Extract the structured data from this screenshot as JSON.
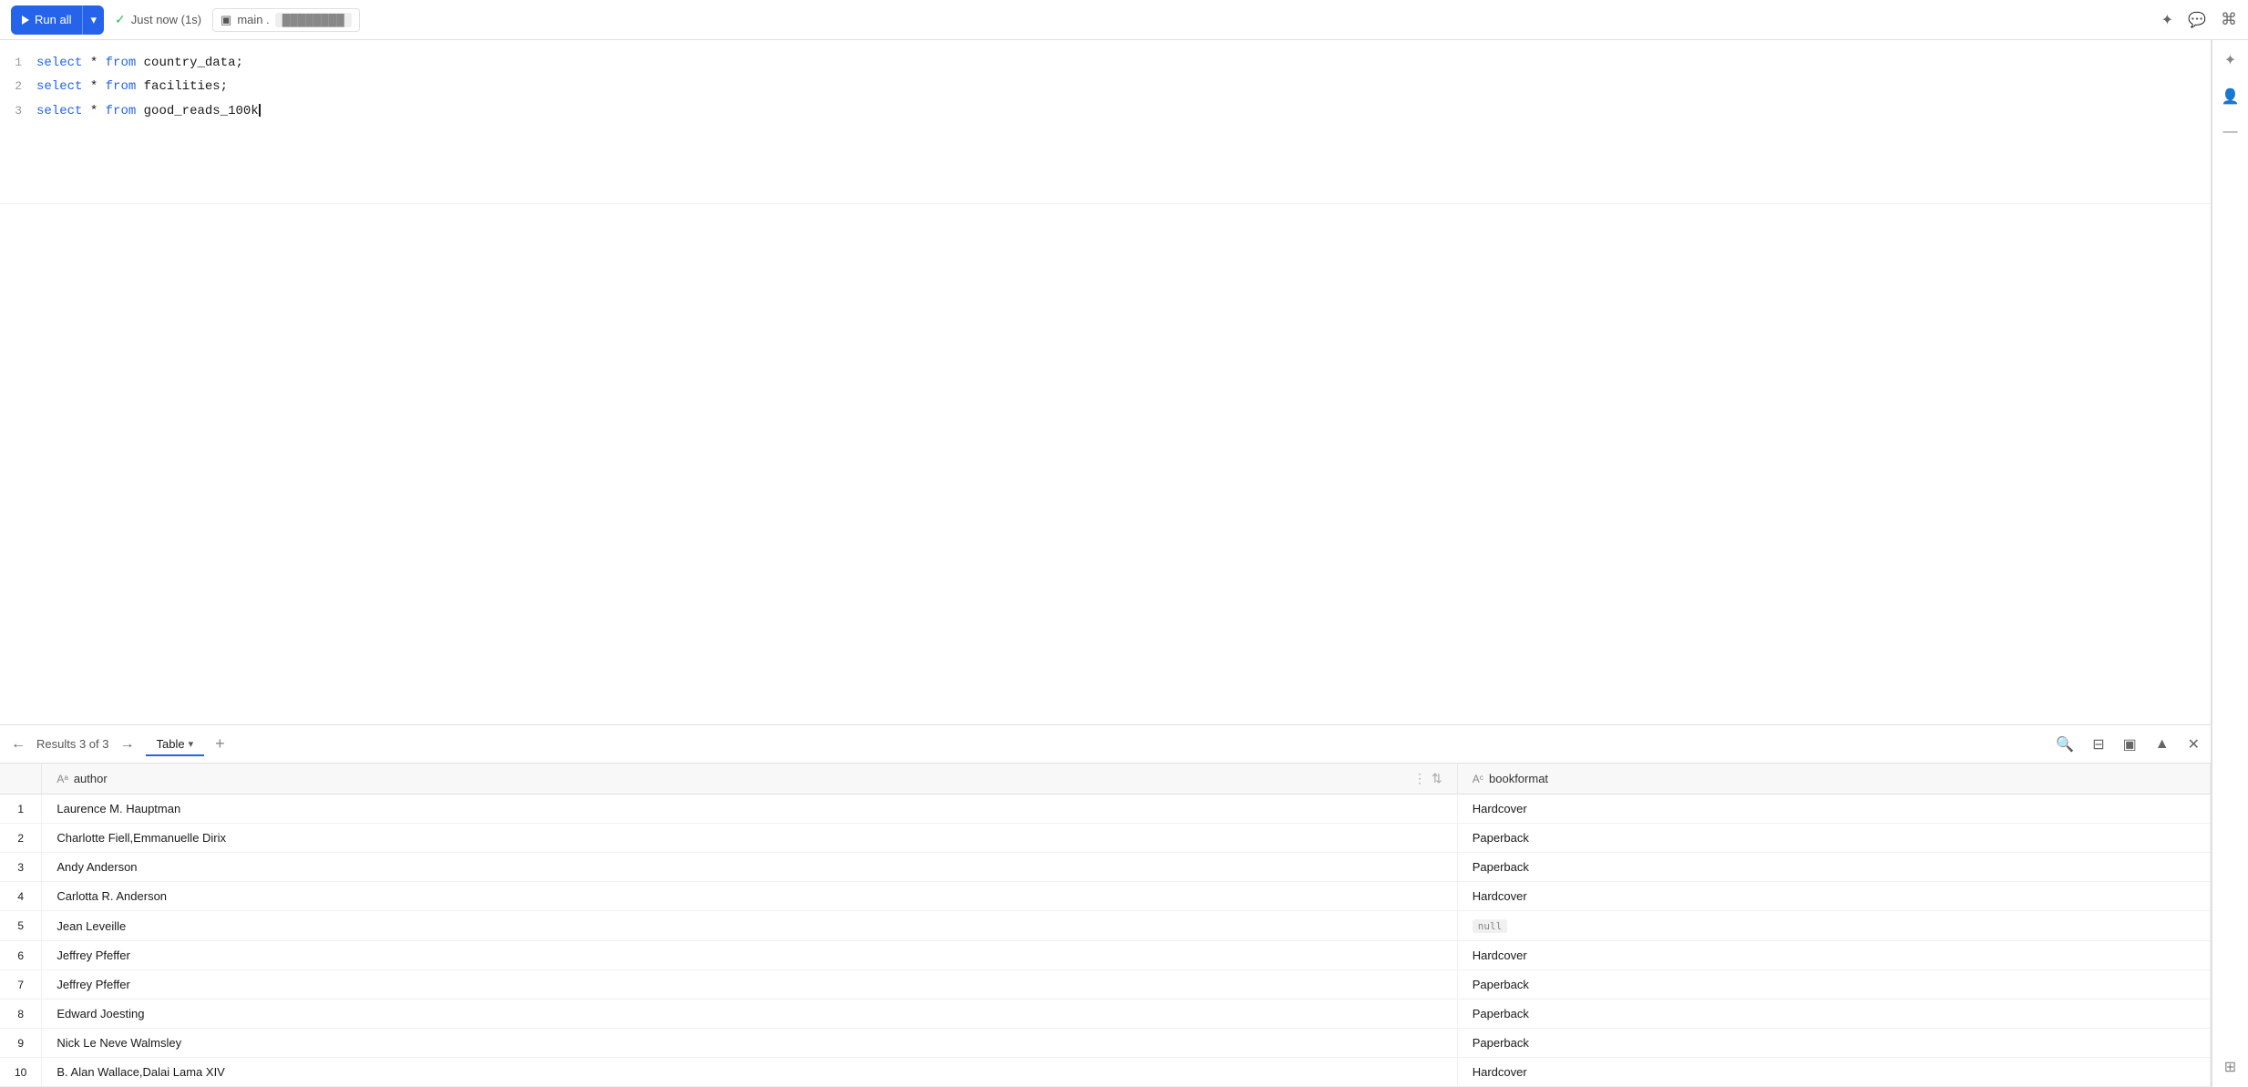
{
  "toolbar": {
    "run_all_label": "Run all",
    "status_label": "Just now (1s)",
    "db_label": "main .",
    "pin_icon": "✦",
    "chat_icon": "💬",
    "cmd_icon": "⌘"
  },
  "editor": {
    "lines": [
      {
        "number": 1,
        "content": "select * from country_data;"
      },
      {
        "number": 2,
        "content": "select * from facilities;"
      },
      {
        "number": 3,
        "content": "select * from good_reads_100k"
      }
    ]
  },
  "results": {
    "label": "Results 3 of 3",
    "tab_label": "Table",
    "columns": [
      {
        "name": "author",
        "type": "Aa"
      },
      {
        "name": "bookformat",
        "type": "Ac"
      }
    ],
    "rows": [
      {
        "num": 1,
        "author": "Laurence M. Hauptman",
        "bookformat": "Hardcover",
        "null": false
      },
      {
        "num": 2,
        "author": "Charlotte Fiell,Emmanuelle Dirix",
        "bookformat": "Paperback",
        "null": false
      },
      {
        "num": 3,
        "author": "Andy Anderson",
        "bookformat": "Paperback",
        "null": false
      },
      {
        "num": 4,
        "author": "Carlotta R. Anderson",
        "bookformat": "Hardcover",
        "null": false
      },
      {
        "num": 5,
        "author": "Jean Leveille",
        "bookformat": "null",
        "null": true
      },
      {
        "num": 6,
        "author": "Jeffrey Pfeffer",
        "bookformat": "Hardcover",
        "null": false
      },
      {
        "num": 7,
        "author": "Jeffrey Pfeffer",
        "bookformat": "Paperback",
        "null": false
      },
      {
        "num": 8,
        "author": "Edward Joesting",
        "bookformat": "Paperback",
        "null": false
      },
      {
        "num": 9,
        "author": "Nick Le Neve Walmsley",
        "bookformat": "Paperback",
        "null": false
      },
      {
        "num": 10,
        "author": "B. Alan Wallace,Dalai Lama XIV",
        "bookformat": "Hardcover",
        "null": false
      }
    ]
  }
}
